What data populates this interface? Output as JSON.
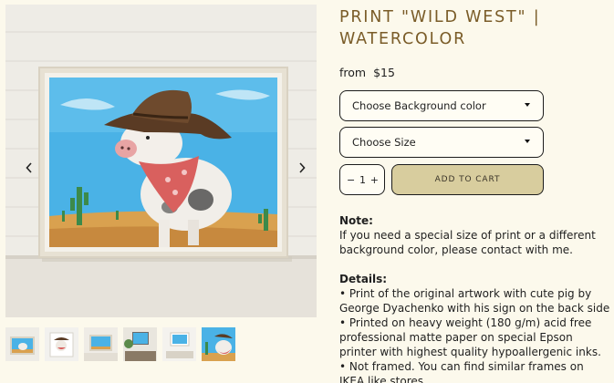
{
  "product": {
    "title": "PRINT \"WILD WEST\" | WATERCOLOR",
    "price_prefix": "from",
    "price": "$15"
  },
  "options": {
    "background_placeholder": "Choose Background color",
    "size_placeholder": "Choose Size"
  },
  "cart": {
    "qty_minus": "−",
    "qty_value": "1",
    "qty_plus": "+",
    "add_label": "ADD TO CART"
  },
  "description": {
    "note_heading": "Note:",
    "note_text": "If you need a special size of print or a different background color, please contact with me.",
    "details_heading": "Details:",
    "details": [
      "• Print of the original artwork with cute pig by George Dyachenko with his sign on the back side",
      "• Printed on heavy weight (180 g/m) acid free professional matte paper on special Epson printer with highest quality hypoallergenic inks.",
      "• Not framed. You can find similar frames on IKEA like stores."
    ]
  },
  "gallery": {
    "prev_icon": "chevron-left-icon",
    "next_icon": "chevron-right-icon",
    "thumbnail_count": 6
  },
  "colors": {
    "background": "#fcf9ec",
    "title": "#7a5c28",
    "cart_button": "#d8cd9e",
    "border": "#1c1c1c"
  }
}
